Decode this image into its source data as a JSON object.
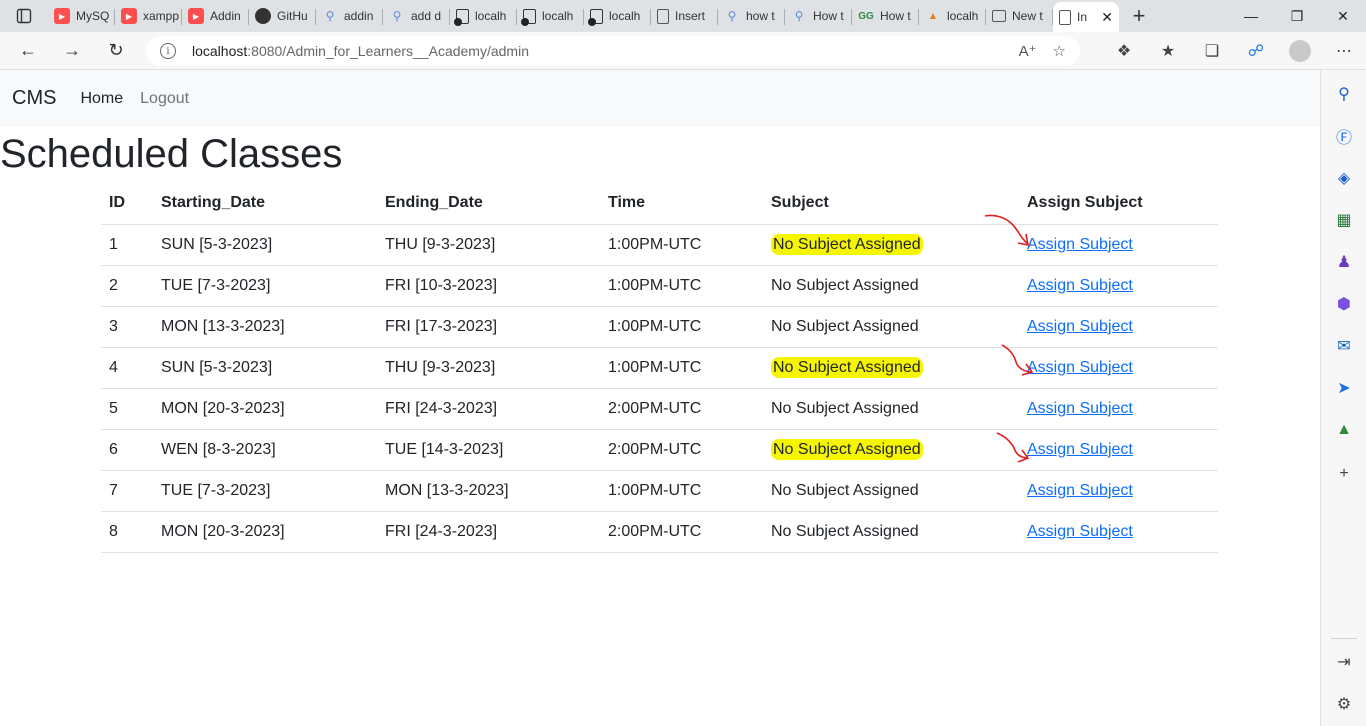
{
  "browser": {
    "tabs": [
      {
        "title": "MySQ",
        "icon": "youtube-icon"
      },
      {
        "title": "xampp",
        "icon": "youtube-icon"
      },
      {
        "title": "Addin",
        "icon": "youtube-icon"
      },
      {
        "title": "GitHu",
        "icon": "github-icon"
      },
      {
        "title": "addin",
        "icon": "search-icon"
      },
      {
        "title": "add d",
        "icon": "search-icon"
      },
      {
        "title": "localh",
        "icon": "local-page-icon"
      },
      {
        "title": "localh",
        "icon": "local-page-icon"
      },
      {
        "title": "localh",
        "icon": "local-page-icon"
      },
      {
        "title": "Insert",
        "icon": "document-icon"
      },
      {
        "title": "how t",
        "icon": "search-icon"
      },
      {
        "title": "How t",
        "icon": "search-icon"
      },
      {
        "title": "How t",
        "icon": "geeksforgeeks-icon"
      },
      {
        "title": "localh",
        "icon": "phpmyadmin-icon"
      },
      {
        "title": "New t",
        "icon": "newtab-icon"
      },
      {
        "title": "In",
        "icon": "document-icon",
        "active": true
      }
    ],
    "url_host": "localhost",
    "url_path": ":8080/Admin_for_Learners__Academy/admin"
  },
  "navbar": {
    "brand": "CMS",
    "links": [
      "Home",
      "Logout"
    ]
  },
  "page": {
    "title": "Scheduled Classes"
  },
  "table": {
    "headers": [
      "ID",
      "Starting_Date",
      "Ending_Date",
      "Time",
      "Subject",
      "Assign Subject"
    ],
    "rows": [
      {
        "id": "1",
        "start": "SUN [5-3-2023]",
        "end": "THU [9-3-2023]",
        "time": "1:00PM-UTC",
        "subject": "No Subject Assigned",
        "action": "Assign Subject",
        "highlighted": true
      },
      {
        "id": "2",
        "start": "TUE [7-3-2023]",
        "end": "FRI [10-3-2023]",
        "time": "1:00PM-UTC",
        "subject": "No Subject Assigned",
        "action": "Assign Subject",
        "highlighted": false
      },
      {
        "id": "3",
        "start": "MON [13-3-2023]",
        "end": "FRI [17-3-2023]",
        "time": "1:00PM-UTC",
        "subject": "No Subject Assigned",
        "action": "Assign Subject",
        "highlighted": false
      },
      {
        "id": "4",
        "start": "SUN [5-3-2023]",
        "end": "THU [9-3-2023]",
        "time": "1:00PM-UTC",
        "subject": "No Subject Assigned",
        "action": "Assign Subject",
        "highlighted": true
      },
      {
        "id": "5",
        "start": "MON [20-3-2023]",
        "end": "FRI [24-3-2023]",
        "time": "2:00PM-UTC",
        "subject": "No Subject Assigned",
        "action": "Assign Subject",
        "highlighted": false
      },
      {
        "id": "6",
        "start": "WEN [8-3-2023]",
        "end": "TUE [14-3-2023]",
        "time": "2:00PM-UTC",
        "subject": "No Subject Assigned",
        "action": "Assign Subject",
        "highlighted": true
      },
      {
        "id": "7",
        "start": "TUE [7-3-2023]",
        "end": "MON [13-3-2023]",
        "time": "1:00PM-UTC",
        "subject": "No Subject Assigned",
        "action": "Assign Subject",
        "highlighted": false
      },
      {
        "id": "8",
        "start": "MON [20-3-2023]",
        "end": "FRI [24-3-2023]",
        "time": "2:00PM-UTC",
        "subject": "No Subject Assigned",
        "action": "Assign Subject",
        "highlighted": false
      }
    ]
  },
  "colors": {
    "highlight": "#f5f500",
    "link": "#0d6efd",
    "annotation_arrow": "#e02020"
  }
}
